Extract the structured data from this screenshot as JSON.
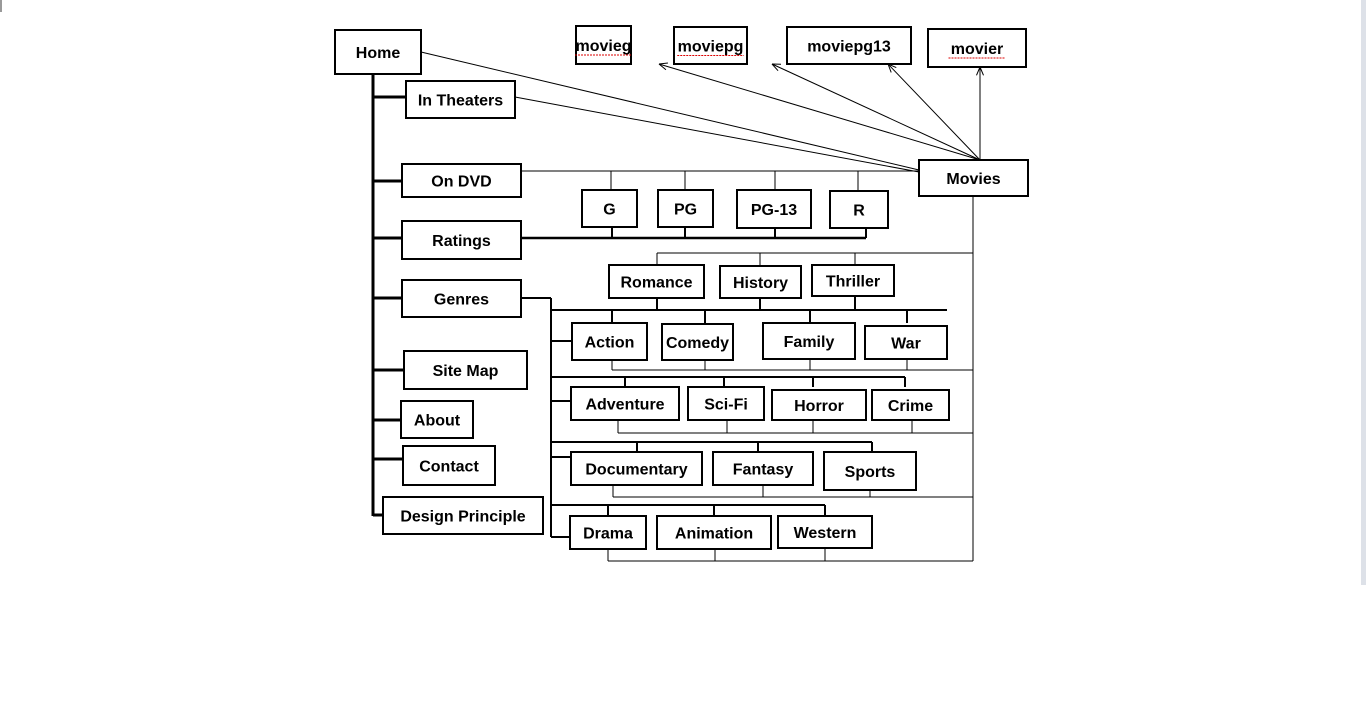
{
  "diagram": {
    "root": "Home",
    "nodes": {
      "home": "Home",
      "in_theaters": "In Theaters",
      "on_dvd": "On DVD",
      "ratings": "Ratings",
      "genres": "Genres",
      "site_map": "Site Map",
      "about": "About",
      "contact": "Contact",
      "design_principle": "Design Principle",
      "movies": "Movies",
      "movieg": "movieg",
      "moviepg": "moviepg",
      "moviepg13": "moviepg13",
      "movier": "movier",
      "g": "G",
      "pg": "PG",
      "pg13": "PG-13",
      "r": "R",
      "romance": "Romance",
      "history": "History",
      "thriller": "Thriller",
      "action": "Action",
      "comedy": "Comedy",
      "family": "Family",
      "war": "War",
      "adventure": "Adventure",
      "scifi": "Sci-Fi",
      "horror": "Horror",
      "crime": "Crime",
      "documentary": "Documentary",
      "fantasy": "Fantasy",
      "sports": "Sports",
      "drama": "Drama",
      "animation": "Animation",
      "western": "Western"
    },
    "spellcheck_underlined": [
      "movieg",
      "moviepg",
      "movier"
    ],
    "line_color": "#000000"
  }
}
